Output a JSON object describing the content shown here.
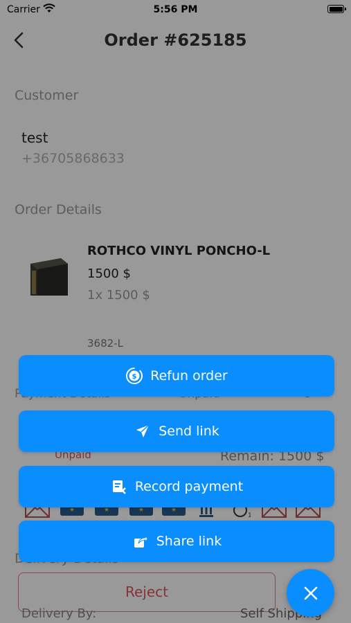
{
  "status_bar": {
    "carrier": "Carrier",
    "time": "5:56 PM"
  },
  "header": {
    "title": "Order #625185"
  },
  "customer": {
    "section_label": "Customer",
    "name": "test",
    "phone": "+36705868633"
  },
  "order_details": {
    "section_label": "Order Details",
    "product_name": "ROTHCO VINYL PONCHO-L",
    "price": "1500 $",
    "qty_line": "1x  1500 $",
    "sku": "3682-L"
  },
  "payment": {
    "section_label": "Payment Details",
    "partial_right_text": "Unpaid",
    "partial_right_text2": "s",
    "status": "Unpaid",
    "remain": "Remain: 1500 $"
  },
  "delivery": {
    "section_label": "Delivery Details",
    "reject_label": "Reject",
    "by_label": "Delivery By:",
    "by_value": "Self Shipping"
  },
  "action_sheet": {
    "buttons": [
      {
        "label": "Refun order",
        "icon": "refund-dollar-icon"
      },
      {
        "label": "Send link",
        "icon": "paper-plane-icon"
      },
      {
        "label": "Record payment",
        "icon": "record-payment-icon"
      },
      {
        "label": "Share link",
        "icon": "share-icon"
      }
    ],
    "close_icon": "close-icon"
  },
  "colors": {
    "accent": "#0a8eff",
    "danger": "#e05555"
  }
}
